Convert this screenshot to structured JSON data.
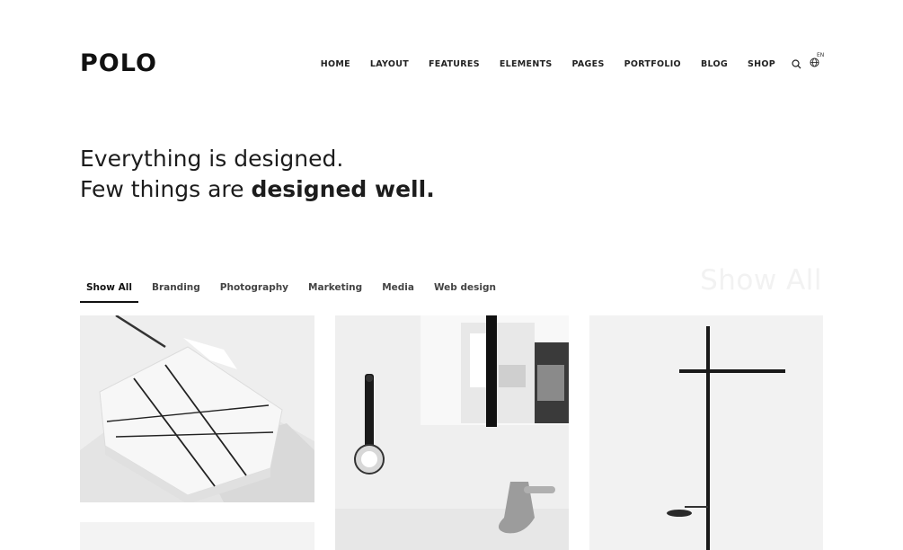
{
  "header": {
    "logo": "POLO",
    "nav": [
      "HOME",
      "LAYOUT",
      "FEATURES",
      "ELEMENTS",
      "PAGES",
      "PORTFOLIO",
      "BLOG",
      "SHOP"
    ],
    "search_icon": "search-icon",
    "language_icon": "globe-icon",
    "language_code": "EN"
  },
  "hero": {
    "line1": "Everything is designed.",
    "line2_prefix": "Few things are ",
    "line2_bold": "designed well."
  },
  "filters": {
    "items": [
      "Show All",
      "Branding",
      "Photography",
      "Marketing",
      "Media",
      "Web design"
    ],
    "active": "Show All",
    "ghost_title": "Show All"
  },
  "portfolio": {
    "items": [
      {
        "name": "bundled-paper-photo"
      },
      {
        "name": "magazine-and-tape-photo"
      },
      {
        "name": "black-cross-stand-photo"
      },
      {
        "name": "fourth-item-photo"
      }
    ]
  },
  "colors": {
    "text": "#1a1a1a",
    "ghost": "#f2f2f2",
    "accent": "#111111"
  }
}
